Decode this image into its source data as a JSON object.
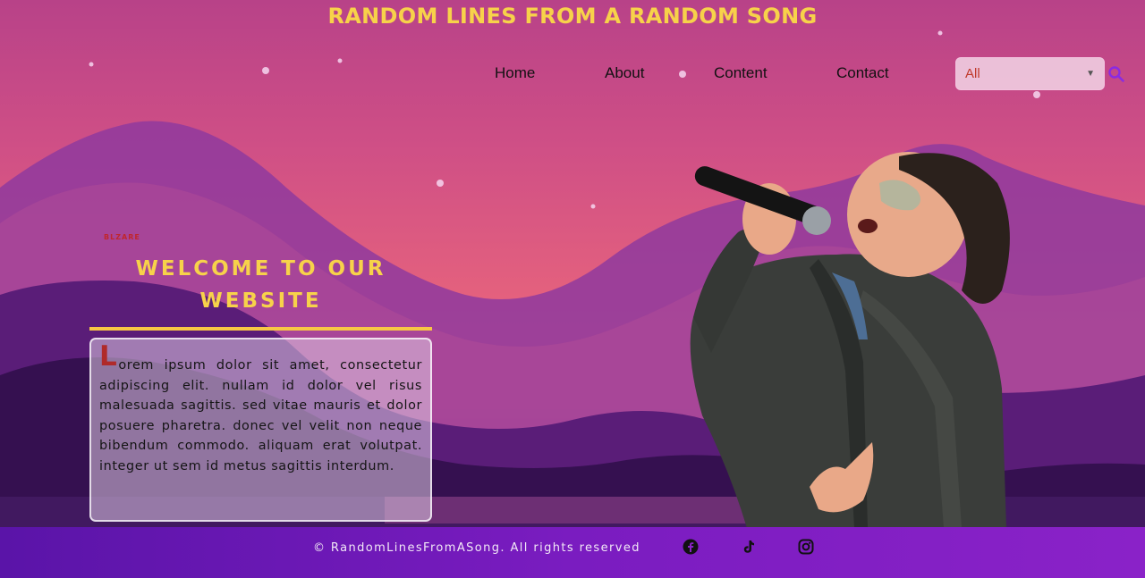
{
  "header": {
    "site_title": "RANDOM LINES FROM A RANDOM SONG"
  },
  "nav": {
    "items": [
      {
        "label": "Home"
      },
      {
        "label": "About"
      },
      {
        "label": "Content"
      },
      {
        "label": "Contact"
      }
    ]
  },
  "search": {
    "filter_selected": "All",
    "icon": "search-icon"
  },
  "hero": {
    "tiny_label": "BLZARE",
    "welcome_title": "WELCOME TO OUR WEBSITE",
    "drop_cap": "L",
    "body_text": "orem ipsum dolor sit amet, consectetur adipiscing elit. nullam id dolor vel risus malesuada sagittis. sed vitae mauris et dolor posuere pharetra. donec vel velit non neque bibendum commodo. aliquam erat volutpat. integer ut sem id metus sagittis interdum."
  },
  "footer": {
    "copyright": "© RandomLinesFromASong. All rights reserved",
    "social": [
      "facebook-icon",
      "tiktok-icon",
      "instagram-icon"
    ]
  },
  "colors": {
    "title_yellow": "#f7d24a",
    "footer_purple": "#7a1cc0",
    "drop_cap_red": "#b02a2a"
  }
}
